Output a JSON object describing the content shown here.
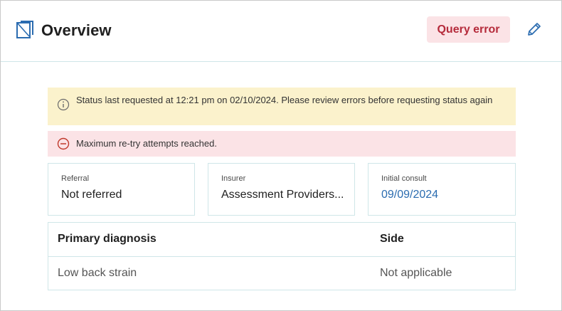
{
  "header": {
    "title": "Overview",
    "status_button_label": "Query error"
  },
  "alerts": {
    "warning": "Status last requested at 12:21 pm on 02/10/2024. Please review errors before requesting status again",
    "error": "Maximum re-try attempts reached."
  },
  "cards": [
    {
      "label": "Referral",
      "value": "Not referred"
    },
    {
      "label": "Insurer",
      "value": "Assessment Providers..."
    },
    {
      "label": "Initial consult",
      "value": "09/09/2024"
    }
  ],
  "diagnosis_table": {
    "columns": [
      "Primary diagnosis",
      "Side"
    ],
    "rows": [
      [
        "Low back strain",
        "Not applicable"
      ]
    ]
  },
  "icons": {
    "overview": "overview-icon",
    "edit": "pencil-icon",
    "warning": "info-circle-icon",
    "error": "minus-circle-icon"
  },
  "colors": {
    "accent": "#2b6cb0",
    "warning_bg": "#fbf2cc",
    "error_bg": "#fbe3e6",
    "error_text": "#b52b3b",
    "border": "#cfe6e8"
  }
}
